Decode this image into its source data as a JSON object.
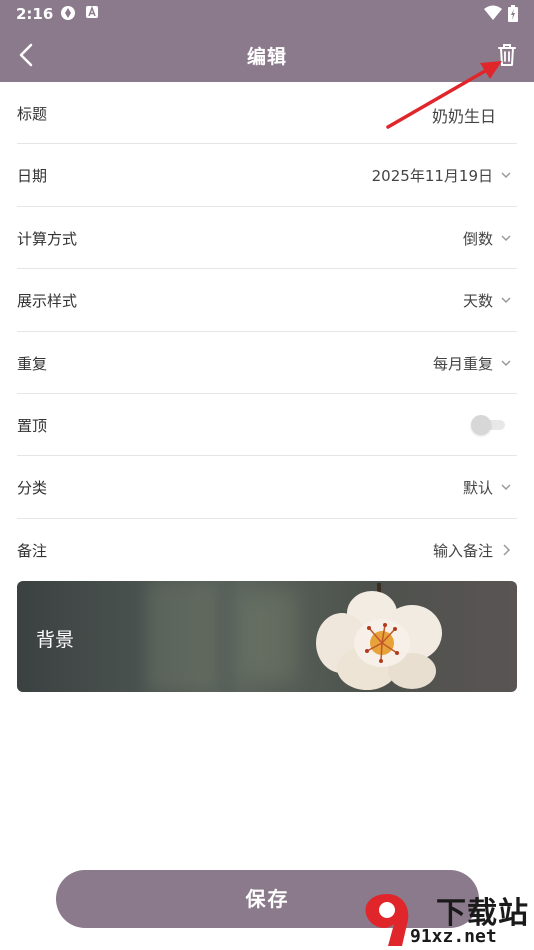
{
  "status_bar": {
    "time": "2:16"
  },
  "app_bar": {
    "title": "编辑",
    "back_icon": "chevron-left-icon",
    "delete_icon": "trash-icon"
  },
  "form": {
    "rows": [
      {
        "label": "标题",
        "value": "奶奶生日",
        "control": "text"
      },
      {
        "label": "日期",
        "value": "2025年11月19日",
        "control": "dropdown"
      },
      {
        "label": "计算方式",
        "value": "倒数",
        "control": "dropdown"
      },
      {
        "label": "展示样式",
        "value": "天数",
        "control": "dropdown"
      },
      {
        "label": "重复",
        "value": "每月重复",
        "control": "dropdown"
      },
      {
        "label": "置顶",
        "value": "",
        "control": "toggle",
        "on": false
      },
      {
        "label": "分类",
        "value": "默认",
        "control": "dropdown"
      },
      {
        "label": "备注",
        "value": "输入备注",
        "control": "link"
      }
    ]
  },
  "background_card": {
    "label": "背景"
  },
  "save_button": {
    "label": "保存"
  },
  "watermark": {
    "text_top": "下载站",
    "text_bottom": "91xz.net"
  },
  "colors": {
    "primary": "#8b7a8b",
    "annotation_arrow": "#e0262b"
  }
}
